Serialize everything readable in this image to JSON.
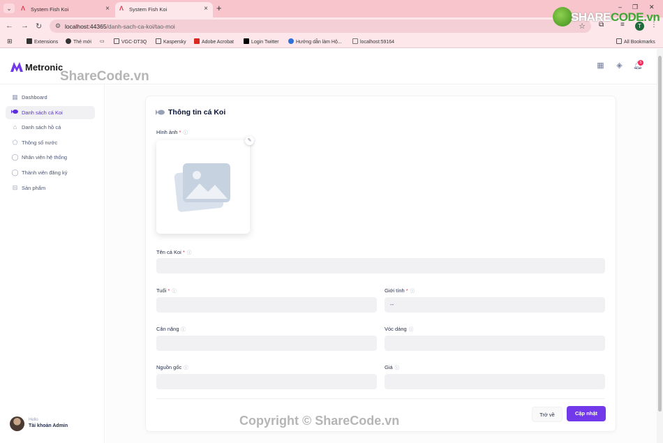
{
  "browser": {
    "tabs": [
      {
        "title": "System Fish Koi"
      },
      {
        "title": "System Fish Koi"
      }
    ],
    "url_host": "localhost:44365",
    "url_path": "/danh-sach-ca-koi/tao-moi",
    "profile_initial": "T",
    "bookmarks": [
      "Extensions",
      "Thẻ mới",
      "VGC-DT3Q",
      "Kaspersky",
      "Adobe Acrobat",
      "Login Twitter",
      "Hướng dẫn làm Hộ...",
      "localhost:59164"
    ],
    "all_bookmarks": "All Bookmarks"
  },
  "watermark": {
    "logo_share": "SHARE",
    "logo_code": "CODE",
    "logo_vn": ".vn",
    "top": "ShareCode.vn",
    "bottom": "Copyright © ShareCode.vn"
  },
  "app": {
    "brand": "Metronic",
    "notification_count": "5",
    "sidebar": [
      {
        "label": "Dashboard",
        "icon": "grid-icon"
      },
      {
        "label": "Danh sách cá Koi",
        "icon": "fish-icon",
        "active": true
      },
      {
        "label": "Danh sách hồ cá",
        "icon": "bank-icon"
      },
      {
        "label": "Thông số nước",
        "icon": "tag-icon"
      },
      {
        "label": "Nhân viên hệ thống",
        "icon": "user-icon"
      },
      {
        "label": "Thành viên đăng ký",
        "icon": "user-edit-icon"
      },
      {
        "label": "Sản phẩm",
        "icon": "basket-icon"
      }
    ],
    "user": {
      "greeting": "Hello",
      "name": "Tài khoản Admin"
    }
  },
  "form": {
    "title": "Thông tin cá Koi",
    "image_label": "Hình ảnh",
    "name_label": "Tên cá Koi",
    "age_label": "Tuổi",
    "gender_label": "Giới tính",
    "gender_value": "--",
    "weight_label": "Cân nặng",
    "shape_label": "Vóc dáng",
    "origin_label": "Nguồn gốc",
    "price_label": "Giá",
    "required_mark": "*",
    "back_button": "Trở về",
    "save_button": "Cập nhật"
  },
  "colors": {
    "accent": "#7239ea",
    "required": "#f8285a",
    "input_bg": "#f1f1f4"
  }
}
